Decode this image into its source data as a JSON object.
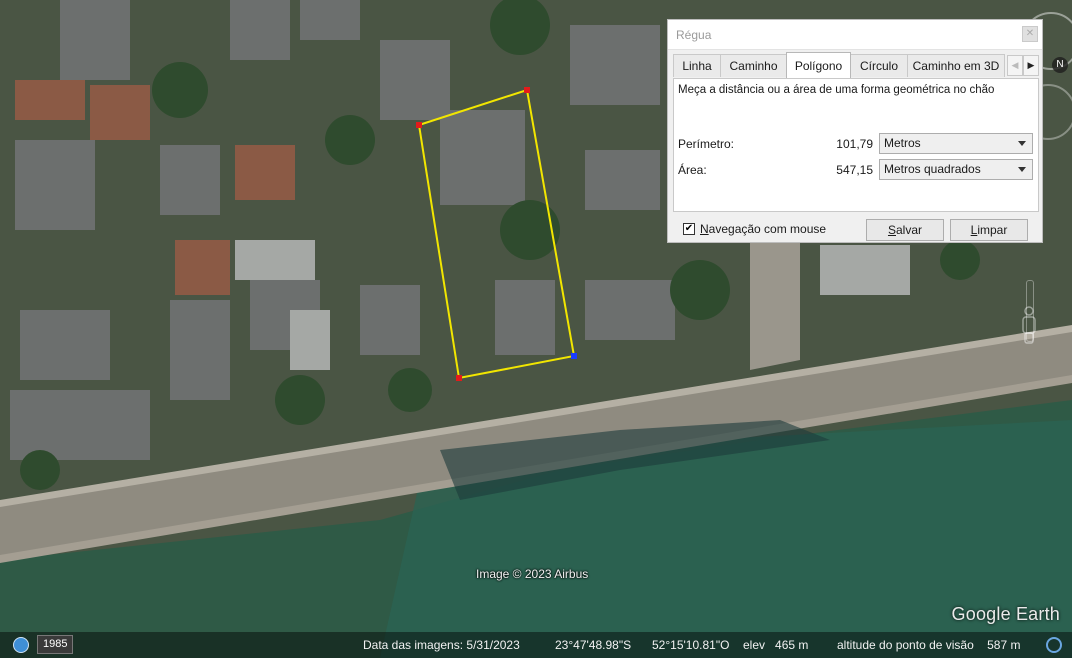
{
  "map": {
    "copyright": "Image © 2023 Airbus",
    "logo": "Google Earth",
    "polygon_color": "#f2e600",
    "vertex_colors": {
      "normal": "#e31b1b",
      "last": "#1a3cff"
    }
  },
  "nav": {
    "compass_label": "N",
    "compass_icon": "compass-icon",
    "look_icon": "look-joystick-icon",
    "zoom_icon": "zoom-slider-icon",
    "pegman_icon": "street-view-pegman-icon"
  },
  "dialog": {
    "title": "Régua",
    "close_icon": "close-icon",
    "tabs": [
      {
        "label": "Linha",
        "active": false
      },
      {
        "label": "Caminho",
        "active": false
      },
      {
        "label": "Polígono",
        "active": true
      },
      {
        "label": "Círculo",
        "active": false
      },
      {
        "label": "Caminho em 3D",
        "active": false
      }
    ],
    "tab_scroll_left_icon": "chevron-left-icon",
    "tab_scroll_right_icon": "chevron-right-icon",
    "description": "Meça a distância ou a área de uma forma geométrica no chão",
    "perimeter": {
      "label": "Perímetro:",
      "value": "101,79",
      "unit": "Metros"
    },
    "area": {
      "label": "Área:",
      "value": "547,15",
      "unit": "Metros quadrados"
    },
    "mouse_nav": {
      "label": "Navegação com mouse",
      "checked": true
    },
    "save_button": "Salvar",
    "clear_button": "Limpar"
  },
  "statusbar": {
    "history_icon": "historical-imagery-icon",
    "year": "1985",
    "image_date": "Data das imagens: 5/31/2023",
    "latitude": "23°47'48.98\"S",
    "longitude": "52°15'10.81\"O",
    "elevation": "elev   465 m",
    "eye_alt": "altitude do ponto de visão    587 m",
    "streaming_icon": "streaming-status-icon"
  }
}
